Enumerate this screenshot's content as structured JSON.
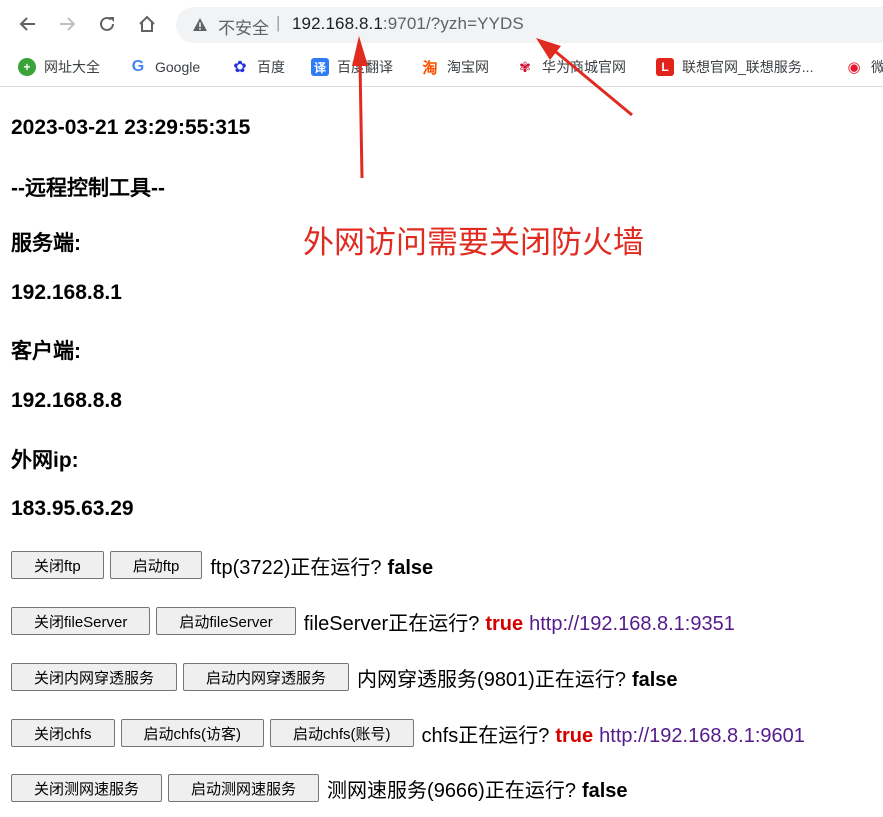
{
  "browser": {
    "insecure_label": "不安全",
    "separator": "|",
    "url_host": "192.168.8.1",
    "url_rest": ":9701/?yzh=YYDS"
  },
  "bookmarks": [
    {
      "label": "网址大全",
      "icon": "hao123-icon",
      "color": "#3aa33a"
    },
    {
      "label": "Google",
      "icon": "google-icon",
      "color": "#4285f4"
    },
    {
      "label": "百度",
      "icon": "baidu-paw-icon",
      "color": "#2932e1"
    },
    {
      "label": "百度翻译",
      "icon": "baidu-translate-icon",
      "color": "#2f7cf6"
    },
    {
      "label": "淘宝网",
      "icon": "taobao-icon",
      "color": "#ff5000"
    },
    {
      "label": "华为商城官网",
      "icon": "huawei-icon",
      "color": "#cf0a2c"
    },
    {
      "label": "联想官网_联想服务...",
      "icon": "lenovo-icon",
      "color": "#e2231a"
    },
    {
      "label": "微",
      "icon": "weibo-icon",
      "color": "#e6162d"
    }
  ],
  "page": {
    "datetime": "2023-03-21 23:29:55:315",
    "tool_title": "--远程控制工具--",
    "server_label": "服务端:",
    "server_ip": "192.168.8.1",
    "client_label": "客户端:",
    "client_ip": "192.168.8.8",
    "wan_label": "外网ip:",
    "wan_ip": "183.95.63.29",
    "annotation": "外网访问需要关闭防火墙"
  },
  "services": [
    {
      "stop": "关闭ftp",
      "start": "启动ftp",
      "status": "ftp(3722)正在运行?",
      "value": "false"
    },
    {
      "stop": "关闭fileServer",
      "start": "启动fileServer",
      "status": "fileServer正在运行?",
      "value": "true",
      "link": "http://192.168.8.1:9351"
    },
    {
      "stop": "关闭内网穿透服务",
      "start": "启动内网穿透服务",
      "status": "内网穿透服务(9801)正在运行?",
      "value": "false"
    },
    {
      "stop": "关闭chfs",
      "start": "启动chfs(访客)",
      "start2": "启动chfs(账号)",
      "status": "chfs正在运行?",
      "value": "true",
      "link": "http://192.168.8.1:9601"
    },
    {
      "stop": "关闭测网速服务",
      "start": "启动测网速服务",
      "status": "测网速服务(9666)正在运行?",
      "value": "false"
    }
  ]
}
